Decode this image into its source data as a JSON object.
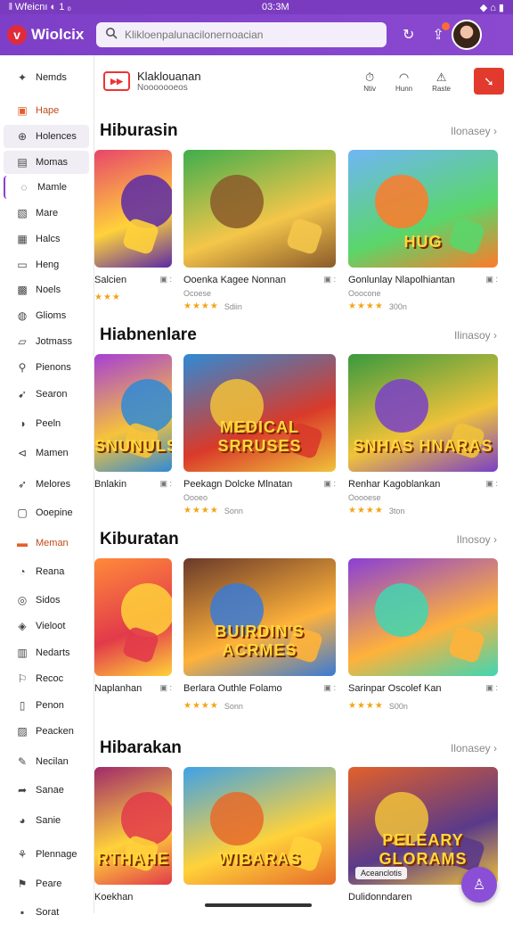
{
  "status": {
    "left": "𝍪 Wfeicnı ◐ 1 ₀",
    "time": "03:3M",
    "right": "◆ ⌂ ▮"
  },
  "topbar": {
    "logo_text": "Wiolcix",
    "logo_letter": "v",
    "search_placeholder": "Klikloenpalunacilonernoacian",
    "icons": [
      "refresh-icon",
      "upload-icon",
      "avatar"
    ]
  },
  "sidebar": {
    "items": [
      {
        "label": "Nemds",
        "icon": "✦"
      },
      {
        "label": "Hape",
        "icon": "▣"
      },
      {
        "label": "Holences",
        "icon": "⊕"
      },
      {
        "label": "Momas",
        "icon": "▤"
      },
      {
        "label": "Mamle",
        "icon": "◌"
      },
      {
        "label": "Mare",
        "icon": "▧"
      },
      {
        "label": "Halcs",
        "icon": "▦"
      },
      {
        "label": "Heng",
        "icon": "▭"
      },
      {
        "label": "Noels",
        "icon": "▩"
      },
      {
        "label": "Glioms",
        "icon": "◍"
      },
      {
        "label": "Jotmass",
        "icon": "▱"
      },
      {
        "label": "Pienons",
        "icon": "⚲"
      },
      {
        "label": "Searon",
        "icon": "➹"
      },
      {
        "label": "Peeln",
        "icon": "◑"
      },
      {
        "label": "Mamen",
        "icon": "⊲"
      },
      {
        "label": "Melores",
        "icon": "➶"
      },
      {
        "label": "Ooepine",
        "icon": "▢"
      },
      {
        "label": "Meman",
        "icon": "▬"
      },
      {
        "label": "Reana",
        "icon": "◔"
      },
      {
        "label": "Sidos",
        "icon": "◎"
      },
      {
        "label": "Vieloot",
        "icon": "◈"
      },
      {
        "label": "Nedarts",
        "icon": "▥"
      },
      {
        "label": "Recoc",
        "icon": "⚐"
      },
      {
        "label": "Penon",
        "icon": "▯"
      },
      {
        "label": "Peacken",
        "icon": "▨"
      },
      {
        "label": "Necilan",
        "icon": "✎"
      },
      {
        "label": "Sanae",
        "icon": "➦"
      },
      {
        "label": "Sanie",
        "icon": "◕"
      },
      {
        "label": "Plennage",
        "icon": "⚘"
      },
      {
        "label": "Peare",
        "icon": "⚑"
      },
      {
        "label": "Sorat",
        "icon": "▪"
      }
    ]
  },
  "subheader": {
    "channel_badge": "▶▶",
    "title": "Klaklouanan",
    "subtitle": "Nooooooeos",
    "actions": [
      {
        "icon": "⏱",
        "label": "Ntiv"
      },
      {
        "icon": "◠",
        "label": "Hunn"
      },
      {
        "icon": "⚠",
        "label": "Raste"
      }
    ],
    "red_button": "➘"
  },
  "sections": [
    {
      "title": "Hiburasin",
      "more": "Ilonasey ›",
      "cards": [
        {
          "title": "Salcien",
          "meta": "▣ :",
          "stars": "★★★",
          "sub": "",
          "art": ""
        },
        {
          "title": "Ooenka Kagee Nonnan",
          "meta": "▣ :",
          "stars": "★★★★",
          "sub": "Ocoese",
          "rating": "Sdiin",
          "art": ""
        },
        {
          "title": "Gonlunlay Nlapolhiantan",
          "meta": "▣ :",
          "stars": "★★★★",
          "sub": "Ooocone",
          "rating": "300n",
          "art": "HUG"
        }
      ]
    },
    {
      "title": "Hiabnenlare",
      "more": "Ilinasoy ›",
      "cards": [
        {
          "title": "Bnlakin",
          "meta": "▣ :",
          "stars": "",
          "sub": "",
          "art": "SNUNULS"
        },
        {
          "title": "Peekagn Dolcke Mlnatan",
          "meta": "▣ :",
          "stars": "★★★★",
          "sub": "Oooeo",
          "rating": "Sonn",
          "art": "MEDICAL SRRUSES"
        },
        {
          "title": "Renhar Kagoblankan",
          "meta": "▣ :",
          "stars": "★★★★",
          "sub": "Ooooese",
          "rating": "3ton",
          "art": "SNHAS HNARAS"
        }
      ]
    },
    {
      "title": "Kiburatan",
      "more": "Ilnosoy ›",
      "cards": [
        {
          "title": "Naplanhan",
          "meta": "▣ :",
          "stars": "",
          "sub": "",
          "art": ""
        },
        {
          "title": "Berlara Outhle Folamo",
          "meta": "▣ :",
          "stars": "★★★★",
          "sub": "",
          "rating": "Sonn",
          "art": "BUIRDIN'S ACRMES"
        },
        {
          "title": "Sarinpar Oscolef Kan",
          "meta": "▣ :",
          "stars": "★★★★",
          "sub": "",
          "rating": "S00n",
          "art": ""
        }
      ]
    },
    {
      "title": "Hibarakan",
      "more": "Ilonasey ›",
      "cards": [
        {
          "title": "Koekhan",
          "meta": "",
          "stars": "",
          "sub": "",
          "art": "RTHAHE"
        },
        {
          "title": "",
          "meta": "",
          "stars": "",
          "sub": "",
          "art": "WIBARAS"
        },
        {
          "title": "Dulidonndaren",
          "meta": "",
          "stars": "",
          "sub": "",
          "art": "PELEARY GLORAMS",
          "overlay": "Aceanclotis"
        }
      ]
    }
  ],
  "colors": {
    "brand": "#7e3fc8",
    "accent": "#e33a2e",
    "star": "#f2a515"
  },
  "fab_icon": "♙"
}
